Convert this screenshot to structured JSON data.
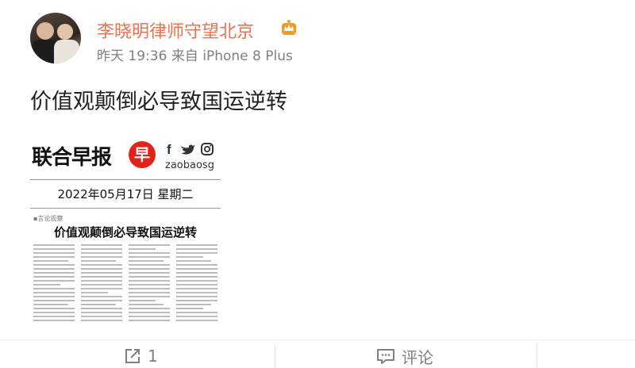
{
  "post": {
    "author": "李晓明律师守望北京",
    "time": "昨天 19:36",
    "source": "来自 iPhone 8 Plus",
    "text": "价值观颠倒必导致国运逆转"
  },
  "clipping": {
    "masthead": "联合早报",
    "badge": "早",
    "handle": "zaobaosg",
    "date": "2022年05月17日 星期二",
    "column_tag": "▪言论观察",
    "headline": "价值观颠倒必导致国运逆转"
  },
  "actions": {
    "share_count": "1",
    "comment_label": "评论"
  },
  "colors": {
    "author_name": "#eb7350",
    "meta_text": "#808080",
    "brand_red": "#e2231a"
  }
}
